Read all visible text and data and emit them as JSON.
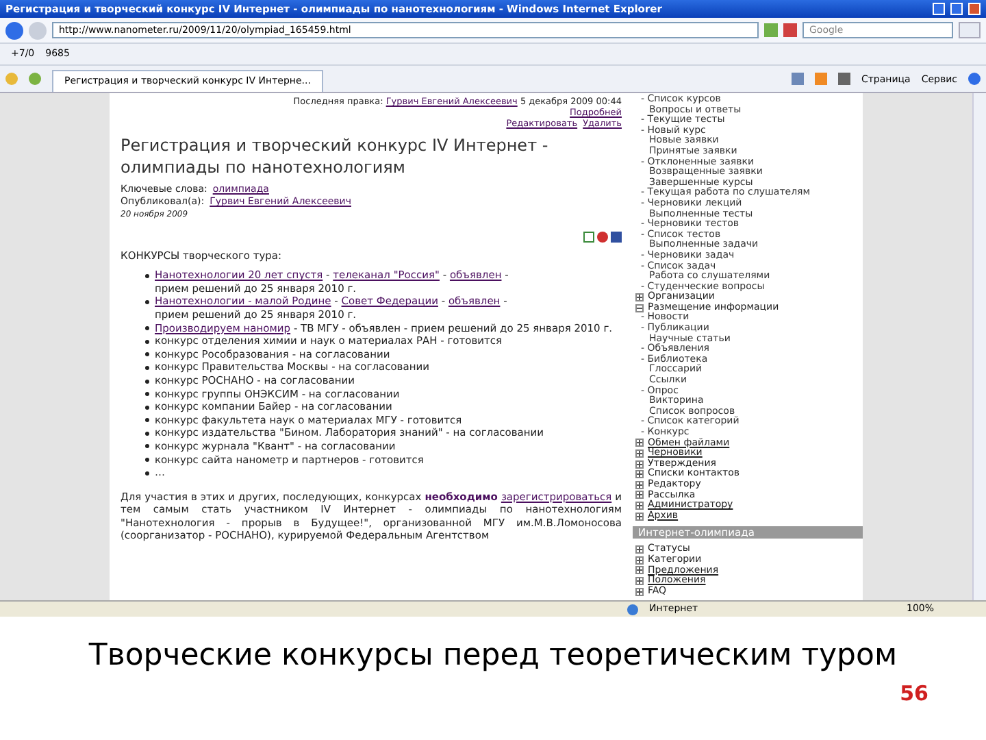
{
  "window": {
    "title": "Регистрация и творческий конкурс IV Интернет - олимпиады по нанотехнологиям - Windows Internet Explorer"
  },
  "address_bar": {
    "url": "http://www.nanometer.ru/2009/11/20/olympiad_165459.html",
    "search_placeholder": "Google"
  },
  "links_bar": {
    "weather": "+7/0",
    "counter": "9685"
  },
  "tab": {
    "title": "Регистрация и творческий конкурс IV Интерне..."
  },
  "command_bar": {
    "page": "Страница",
    "tools": "Сервис"
  },
  "article": {
    "edit_label": "Последняя правка:",
    "edit_author": "Гурвич Евгений Алексеевич",
    "edit_date": "5 декабря 2009 00:44",
    "more": "Подробней",
    "edit": "Редактировать",
    "delete": "Удалить",
    "title": "Регистрация и творческий конкурс IV Интернет - олимпиады по нанотехнологиям",
    "keywords_label": "Ключевые слова:",
    "keywords": "олимпиада",
    "author_label": "Опубликовал(а):",
    "author": "Гурвич Евгений Алексеевич",
    "date": "20 ноября 2009",
    "list_title": "КОНКУРСЫ творческого тура:",
    "separator": "-",
    "items": [
      {
        "parts": [
          {
            "text": "Нанотехнологии 20 лет спустя",
            "link": true
          },
          {
            "text": "телеканал \"Россия\"",
            "link": true
          },
          {
            "text": "объявлен",
            "link": true
          },
          {
            "text": "прием решений до 25 января 2010 г.",
            "link": false
          }
        ]
      },
      {
        "parts": [
          {
            "text": "Нанотехнологии - малой Родине",
            "link": true
          },
          {
            "text": "Совет Федерации",
            "link": true
          },
          {
            "text": "объявлен",
            "link": true
          },
          {
            "text": "прием решений до 25 января 2010 г.",
            "link": false
          }
        ]
      },
      {
        "parts": [
          {
            "text": "Производируем наномир",
            "link": true
          },
          {
            "text": "ТВ МГУ - объявлен - прием решений до 25 января 2010 г.",
            "link": false
          }
        ]
      },
      {
        "parts": [
          {
            "text": "конкурс отделения химии и наук о материалах РАН - готовится",
            "link": false
          }
        ]
      },
      {
        "parts": [
          {
            "text": "конкурс Рособразования - на согласовании",
            "link": false
          }
        ]
      },
      {
        "parts": [
          {
            "text": "конкурс Правительства Москвы - на согласовании",
            "link": false
          }
        ]
      },
      {
        "parts": [
          {
            "text": "конкурс РОСНАНО - на согласовании",
            "link": false
          }
        ]
      },
      {
        "parts": [
          {
            "text": "конкурс группы ОНЭКСИМ - на согласовании",
            "link": false
          }
        ]
      },
      {
        "parts": [
          {
            "text": "конкурс компании Байер - на согласовании",
            "link": false
          }
        ]
      },
      {
        "parts": [
          {
            "text": "конкурс факультета наук о материалах МГУ - готовится",
            "link": false
          }
        ]
      },
      {
        "parts": [
          {
            "text": "конкурс издательства \"Бином. Лаборатория знаний\" - на согласовании",
            "link": false
          }
        ]
      },
      {
        "parts": [
          {
            "text": "конкурс журнала \"Квант\" - на согласовании",
            "link": false
          }
        ]
      },
      {
        "parts": [
          {
            "text": "конкурс сайта нанометр и партнеров - готовится",
            "link": false
          }
        ]
      },
      {
        "parts": [
          {
            "text": "…",
            "link": false
          }
        ]
      }
    ],
    "para_before": "Для участия в этих и других, последующих, конкурсах",
    "para_emphasis": "необходимо",
    "para_link": "зарегистрироваться",
    "para_after": "и тем самым стать участником IV Интернет - олимпиады по нанотехнологиям \"Нанотехнология - прорыв в Будущее!\", организованной МГУ им.М.В.Ломоносова (соорганизатор - РОСНАНО), курируемой Федеральным Агентством"
  },
  "sidebar": {
    "items": [
      {
        "kind": "dash",
        "label": "- Список курсов"
      },
      {
        "kind": "plain",
        "label": "Вопросы и ответы"
      },
      {
        "kind": "dash",
        "label": "- Текущие тесты"
      },
      {
        "kind": "dash",
        "label": "- Новый курс"
      },
      {
        "kind": "plain",
        "label": "Новые заявки"
      },
      {
        "kind": "plain",
        "label": "Принятые заявки"
      },
      {
        "kind": "dash",
        "label": "- Отклоненные заявки"
      },
      {
        "kind": "plain",
        "label": "Возвращенные заявки"
      },
      {
        "kind": "plain",
        "label": "Завершенные курсы"
      },
      {
        "kind": "dash",
        "label": "- Текущая работа по слушателям"
      },
      {
        "kind": "dash",
        "label": "- Черновики лекций"
      },
      {
        "kind": "plain",
        "label": "Выполненные тесты"
      },
      {
        "kind": "dash",
        "label": "- Черновики тестов"
      },
      {
        "kind": "dash",
        "label": "- Список тестов"
      },
      {
        "kind": "plain",
        "label": "Выполненные задачи"
      },
      {
        "kind": "dash",
        "label": "- Черновики задач"
      },
      {
        "kind": "dash",
        "label": "- Список задач"
      },
      {
        "kind": "plain",
        "label": "Работа со слушателями"
      },
      {
        "kind": "dash",
        "label": "- Студенческие вопросы"
      },
      {
        "kind": "node",
        "label": "Организации",
        "expanded": false,
        "link": false
      },
      {
        "kind": "node",
        "label": "Размещение информации",
        "expanded": true,
        "link": false
      },
      {
        "kind": "dash",
        "label": "- Новости"
      },
      {
        "kind": "dash",
        "label": "- Публикации"
      },
      {
        "kind": "plain",
        "label": "Научные статьи"
      },
      {
        "kind": "dash",
        "label": "- Объявления"
      },
      {
        "kind": "dash",
        "label": "- Библиотека"
      },
      {
        "kind": "plain",
        "label": "Глоссарий"
      },
      {
        "kind": "plain",
        "label": "Ссылки"
      },
      {
        "kind": "dash",
        "label": "- Опрос"
      },
      {
        "kind": "plain",
        "label": "Викторина"
      },
      {
        "kind": "plain",
        "label": "Список вопросов"
      },
      {
        "kind": "dash",
        "label": "- Список категорий"
      },
      {
        "kind": "dash",
        "label": "- Конкурс"
      },
      {
        "kind": "node",
        "label": "Обмен файлами",
        "expanded": false,
        "link": true
      },
      {
        "kind": "node",
        "label": "Черновики",
        "expanded": false,
        "link": true
      },
      {
        "kind": "node",
        "label": "Утверждения",
        "expanded": false,
        "link": false
      },
      {
        "kind": "node",
        "label": "Списки контактов",
        "expanded": false,
        "link": false
      },
      {
        "kind": "node",
        "label": "Редактору",
        "expanded": false,
        "link": false
      },
      {
        "kind": "node",
        "label": "Рассылка",
        "expanded": false,
        "link": false
      },
      {
        "kind": "node",
        "label": "Администратору",
        "expanded": false,
        "link": true
      },
      {
        "kind": "node",
        "label": "Архив",
        "expanded": false,
        "link": true
      },
      {
        "kind": "header",
        "label": "Интернет-олимпиада"
      },
      {
        "kind": "node",
        "label": "Статусы",
        "expanded": false,
        "link": false
      },
      {
        "kind": "node",
        "label": "Категории",
        "expanded": false,
        "link": false
      },
      {
        "kind": "node",
        "label": "Предложения",
        "expanded": false,
        "link": true
      },
      {
        "kind": "node",
        "label": "Положения",
        "expanded": false,
        "link": true
      },
      {
        "kind": "node",
        "label": "FAQ",
        "expanded": false,
        "link": false
      }
    ]
  },
  "status_bar": {
    "zone": "Интернет",
    "zoom": "100%"
  },
  "slide": {
    "caption": "Творческие конкурсы перед теоретическим туром",
    "page_number": "56"
  }
}
